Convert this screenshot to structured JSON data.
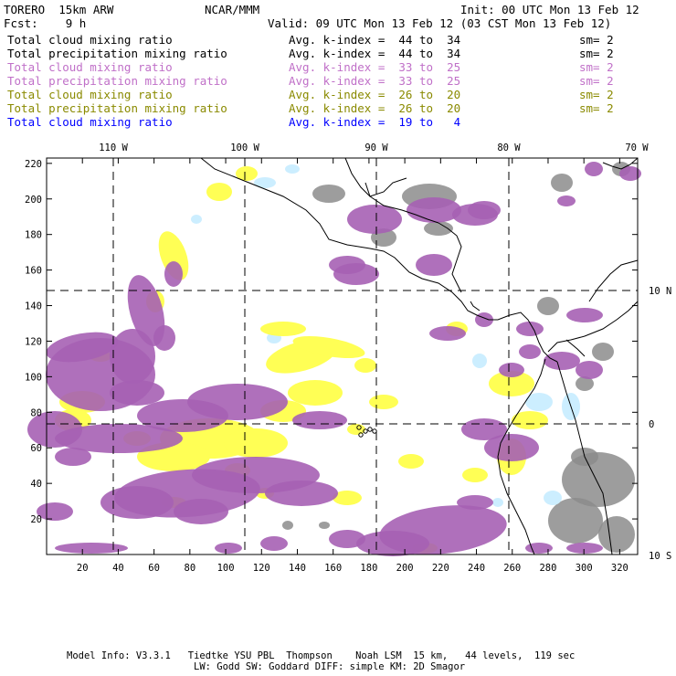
{
  "header": {
    "model": "TORERO  15km ARW",
    "center": "NCAR/MMM",
    "init": "Init: 00 UTC Mon 13 Feb 12",
    "fcst": "Fcst:    9 h",
    "valid": "Valid: 09 UTC Mon 13 Feb 12 (03 CST Mon 13 Feb 12)"
  },
  "legend": [
    {
      "field": "Total cloud mixing ratio",
      "kindex": "Avg. k-index =  44 to  34",
      "sm": "sm= 2",
      "color": "#000000"
    },
    {
      "field": "Total precipitation mixing ratio",
      "kindex": "Avg. k-index =  44 to  34",
      "sm": "sm= 2",
      "color": "#000000"
    },
    {
      "field": "Total cloud mixing ratio",
      "kindex": "Avg. k-index =  33 to  25",
      "sm": "sm= 2",
      "color": "#c070c8"
    },
    {
      "field": "Total precipitation mixing ratio",
      "kindex": "Avg. k-index =  33 to  25",
      "sm": "sm= 2",
      "color": "#c070c8"
    },
    {
      "field": "Total cloud mixing ratio",
      "kindex": "Avg. k-index =  26 to  20",
      "sm": "sm= 2",
      "color": "#8a8a00"
    },
    {
      "field": "Total precipitation mixing ratio",
      "kindex": "Avg. k-index =  26 to  20",
      "sm": "sm= 2",
      "color": "#8a8a00"
    },
    {
      "field": "Total cloud mixing ratio",
      "kindex": "Avg. k-index =  19 to   4",
      "sm": "",
      "color": "#0000ff"
    }
  ],
  "axes": {
    "x_ticks": [
      "20",
      "40",
      "60",
      "80",
      "100",
      "120",
      "140",
      "160",
      "180",
      "200",
      "220",
      "240",
      "260",
      "280",
      "300",
      "320"
    ],
    "y_ticks": [
      "20",
      "40",
      "60",
      "80",
      "100",
      "120",
      "140",
      "160",
      "180",
      "200",
      "220"
    ],
    "lon_labels": [
      "110 W",
      "100 W",
      "90 W",
      "80 W",
      "70 W"
    ],
    "lat_labels": [
      "10 N",
      "0",
      "10 S"
    ]
  },
  "footer": {
    "line1": "Model Info: V3.3.1   Tiedtke YSU PBL  Thompson    Noah LSM  15 km,   44 levels,  119 sec",
    "line2": "LW: Godd SW: Goddard DIFF: simple KM: 2D Smagor"
  },
  "colors": {
    "purple": "#a660b4",
    "yellow": "#ffff55",
    "gray": "#8c8c8c",
    "lightblue": "#cceeff"
  }
}
